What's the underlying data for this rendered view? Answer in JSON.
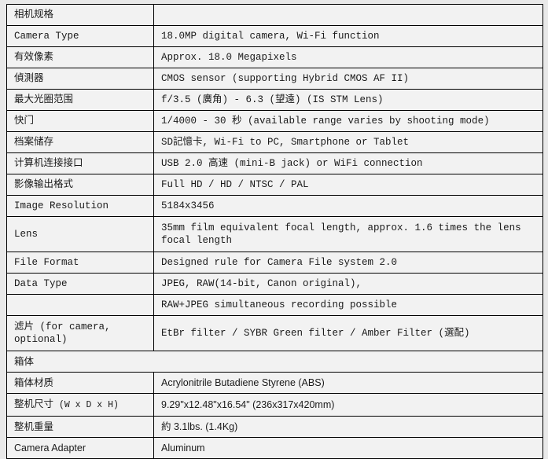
{
  "table": {
    "columns": [
      "spec-name",
      "spec-value"
    ],
    "rows": [
      {
        "name": "camera-spec-header",
        "label": "相机规格",
        "value": "",
        "style": "mono",
        "span": false
      },
      {
        "name": "camera-type",
        "label": "Camera Type",
        "value": "18.0MP digital camera, Wi-Fi function",
        "style": "mono",
        "span": false
      },
      {
        "name": "effective-pixels",
        "label": "有效像素",
        "value": "Approx. 18.0 Megapixels",
        "style": "mono",
        "span": false
      },
      {
        "name": "sensor",
        "label": "偵測器",
        "value": "CMOS sensor (supporting Hybrid CMOS AF II)",
        "style": "mono",
        "span": false
      },
      {
        "name": "max-aperture-range",
        "label": "最大光圈范围",
        "value": "f/3.5 (廣角) - 6.3 (望遠) (IS STM Lens)",
        "style": "mono",
        "span": false
      },
      {
        "name": "shutter",
        "label": "快门",
        "value": "1/4000 - 30 秒 (available range varies by shooting mode)",
        "style": "mono",
        "span": false
      },
      {
        "name": "file-storage",
        "label": "档案储存",
        "value": "SD記憶卡, Wi-Fi to PC, Smartphone or Tablet",
        "style": "mono",
        "span": false
      },
      {
        "name": "computer-interface",
        "label": "计算机连接接口",
        "value": "USB 2.0 高速 (mini-B jack) or WiFi connection",
        "style": "mono",
        "span": false
      },
      {
        "name": "video-output-format",
        "label": "影像输出格式",
        "value": "Full HD / HD / NTSC / PAL",
        "style": "mono",
        "span": false
      },
      {
        "name": "image-resolution",
        "label": "Image Resolution",
        "value": "5184x3456",
        "style": "mono",
        "span": false
      },
      {
        "name": "lens",
        "label": "Lens",
        "value": "35mm film equivalent focal length, approx. 1.6 times the lens focal length",
        "style": "mono",
        "span": false,
        "tall": true
      },
      {
        "name": "file-format",
        "label": "File Format",
        "value": "Designed rule for Camera File system 2.0",
        "style": "mono",
        "span": false
      },
      {
        "name": "data-type",
        "label": "Data Type",
        "value": "JPEG, RAW(14-bit, Canon original),",
        "style": "mono",
        "span": false
      },
      {
        "name": "data-type-continued",
        "label": "",
        "value": "RAW+JPEG simultaneous recording possible",
        "style": "mono",
        "span": false
      },
      {
        "name": "filter",
        "label": "滤片 (for camera, optional)",
        "value": "EtBr filter / SYBR Green filter / Amber Filter (選配)",
        "style": "mono",
        "span": false,
        "tall": true
      },
      {
        "name": "enclosure-section",
        "label": "箱体",
        "value": "",
        "style": "sans",
        "span": true
      },
      {
        "name": "enclosure-material",
        "label": "箱体材质",
        "value": "Acrylonitrile Butadiene Styrene (ABS)",
        "style": "sans",
        "span": false
      },
      {
        "name": "overall-dimensions",
        "label": "整机尺寸 (W x D x H)",
        "label_main": "整机尺寸",
        "label_units": "(W x D x H)",
        "value": "9.29\"x12.48\"x16.54\" (236x317x420mm)",
        "style": "sans",
        "span": false,
        "mixed": true
      },
      {
        "name": "overall-weight",
        "label": "整机重量",
        "value": "約 3.1lbs. (1.4Kg)",
        "style": "sans",
        "span": false
      },
      {
        "name": "camera-adapter",
        "label": "Camera Adapter",
        "value": "Aluminum",
        "style": "sans",
        "span": false
      }
    ]
  },
  "colors": {
    "page_background": "#e9e9e9",
    "cell_background": "#f2f2f2",
    "border": "#000000",
    "text": "#1a1a1a"
  }
}
